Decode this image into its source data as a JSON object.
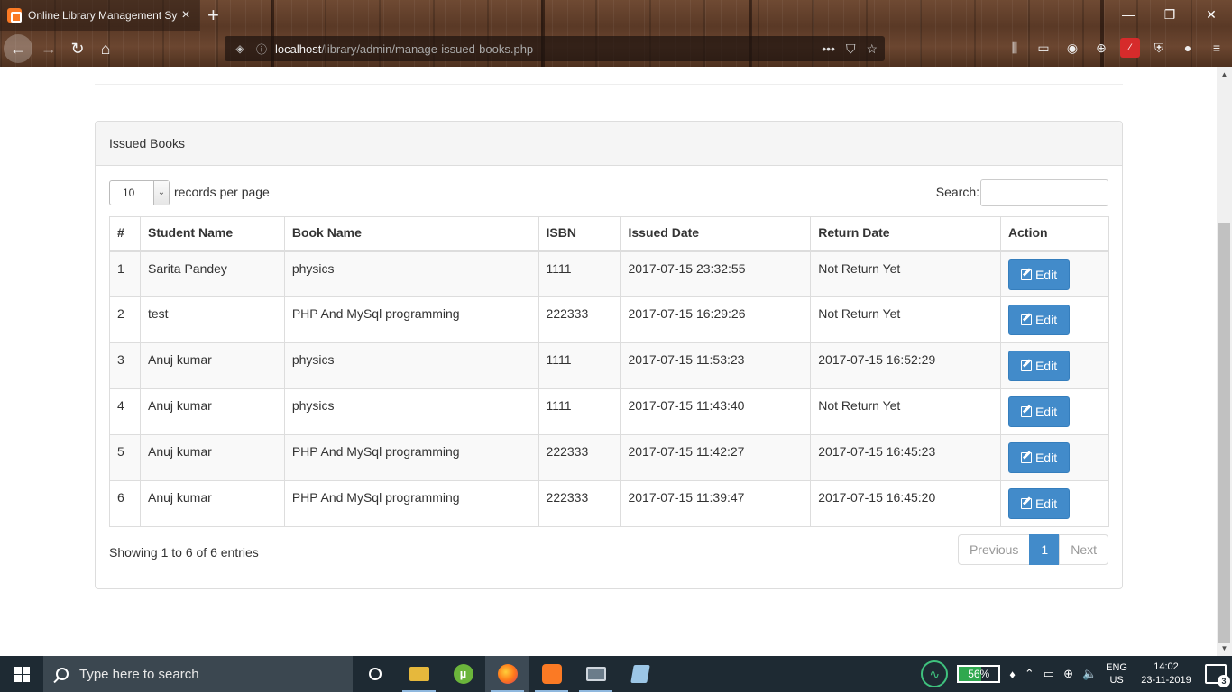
{
  "browser": {
    "tab_title": "Online Library Management Sy",
    "url_host": "localhost",
    "url_path": "/library/admin/manage-issued-books.php",
    "url_more": "•••"
  },
  "panel": {
    "heading": "Issued Books"
  },
  "table_controls": {
    "length_value": "10",
    "length_label": "records per page",
    "search_label": "Search:",
    "search_value": ""
  },
  "table": {
    "headers": [
      "#",
      "Student Name",
      "Book Name",
      "ISBN",
      "Issued Date",
      "Return Date",
      "Action"
    ],
    "rows": [
      {
        "num": "1",
        "student": "Sarita Pandey",
        "book": "physics",
        "isbn": "1111",
        "issued": "2017-07-15 23:32:55",
        "returned": "Not Return Yet",
        "action": "Edit"
      },
      {
        "num": "2",
        "student": "test",
        "book": "PHP And MySql programming",
        "isbn": "222333",
        "issued": "2017-07-15 16:29:26",
        "returned": "Not Return Yet",
        "action": "Edit"
      },
      {
        "num": "3",
        "student": "Anuj kumar",
        "book": "physics",
        "isbn": "1111",
        "issued": "2017-07-15 11:53:23",
        "returned": "2017-07-15 16:52:29",
        "action": "Edit"
      },
      {
        "num": "4",
        "student": "Anuj kumar",
        "book": "physics",
        "isbn": "1111",
        "issued": "2017-07-15 11:43:40",
        "returned": "Not Return Yet",
        "action": "Edit"
      },
      {
        "num": "5",
        "student": "Anuj kumar",
        "book": "PHP And MySql programming",
        "isbn": "222333",
        "issued": "2017-07-15 11:42:27",
        "returned": "2017-07-15 16:45:23",
        "action": "Edit"
      },
      {
        "num": "6",
        "student": "Anuj kumar",
        "book": "PHP And MySql programming",
        "isbn": "222333",
        "issued": "2017-07-15 11:39:47",
        "returned": "2017-07-15 16:45:20",
        "action": "Edit"
      }
    ]
  },
  "footer": {
    "info": "Showing 1 to 6 of 6 entries",
    "prev": "Previous",
    "page": "1",
    "next": "Next"
  },
  "taskbar": {
    "search_placeholder": "Type here to search",
    "battery_percent": "56%",
    "lang_line1": "ENG",
    "lang_line2": "US",
    "time": "14:02",
    "date": "23-11-2019",
    "notification_count": "3"
  },
  "colors": {
    "primary": "#428bca",
    "panel_heading_bg": "#f5f5f5",
    "taskbar_bg": "#1e2a33"
  }
}
